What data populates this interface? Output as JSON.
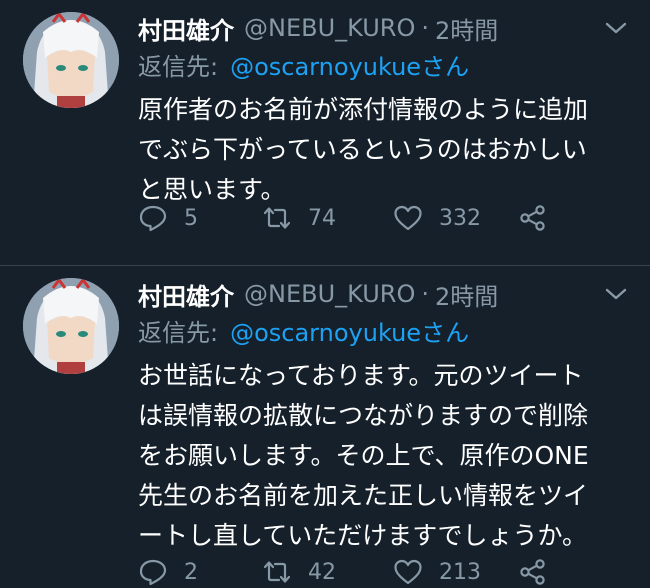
{
  "tweets": [
    {
      "display_name": "村田雄介",
      "handle": "@NEBU_KURO",
      "separator": "·",
      "time": "2時間",
      "reply_prefix": "返信先:",
      "reply_mention": "@oscarnoyukueさん",
      "text_lines": [
        "原作者のお名前が添付情報のように追加",
        "でぶら下がっているというのはおかしい",
        "と思います。"
      ],
      "replies": "5",
      "retweets": "74",
      "likes": "332"
    },
    {
      "display_name": "村田雄介",
      "handle": "@NEBU_KURO",
      "separator": "·",
      "time": "2時間",
      "reply_prefix": "返信先:",
      "reply_mention": "@oscarnoyukueさん",
      "text_lines": [
        "お世話になっております。元のツイート",
        "は誤情報の拡散につながりますので削除",
        "をお願いします。その上で、原作のONE",
        "先生のお名前を加えた正しい情報をツイ",
        "ートし直していただけますでしょうか。"
      ],
      "replies": "2",
      "retweets": "42",
      "likes": "213"
    }
  ],
  "icons": {
    "avatar": "avatar-image",
    "more": "chevron-down-icon",
    "reply": "reply-icon",
    "retweet": "retweet-icon",
    "like": "heart-icon",
    "share": "share-icon"
  },
  "colors": {
    "background": "#15202b",
    "text": "#ffffff",
    "secondary": "#8899a6",
    "link": "#1da1f2",
    "divider": "#38444d"
  }
}
